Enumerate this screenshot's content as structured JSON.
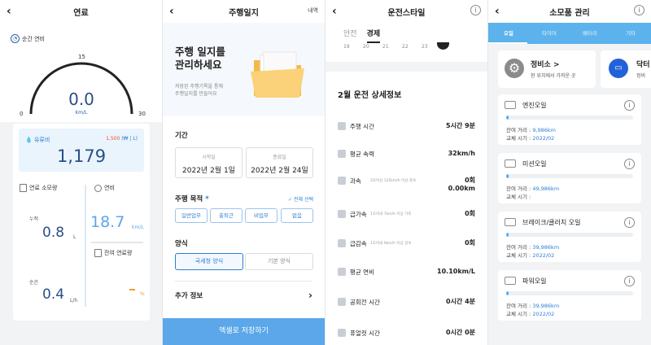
{
  "panel1": {
    "title": "연료",
    "instant_label": "순간 연비",
    "gauge": {
      "min": "0",
      "mid": "15",
      "max": "30",
      "value": "0.0",
      "unit": "km/L",
      "level": 0
    },
    "fuel_cost": {
      "label": "유류비",
      "rate": "1,500",
      "rate_unit": "(₩ | L)",
      "value": "1,179"
    },
    "consumption_label": "연료 소모량",
    "efficiency_label": "연비",
    "cumulative_label": "누적",
    "cumulative_value": "0.8",
    "cumulative_unit": "L",
    "efficiency_value": "18.7",
    "efficiency_unit": "km/L",
    "remaining_label": "잔여 연료량",
    "instant2_label": "순간",
    "instant2_value": "0.4",
    "instant2_unit": "L/h",
    "remaining_unit": "%",
    "colors": {
      "accent": "#2b4f85",
      "blue": "#2d7fd3",
      "orange": "#f29a3a"
    }
  },
  "panel2": {
    "title": "주행일지",
    "right_link": "내역",
    "hero_title": [
      "주행 일지를",
      "관리하세요"
    ],
    "hero_desc": [
      "저장된 주행기록을 통해",
      "주행일지를 만들어요"
    ],
    "period_label": "기간",
    "start": {
      "label": "시작일",
      "value": "2022년 2월 1일"
    },
    "end": {
      "label": "종료일",
      "value": "2022년 2월 24일"
    },
    "purpose_label": "주행 목적",
    "purpose_required": "*",
    "select_all": "✓ 전체 선택",
    "purposes": [
      "일반업무",
      "출퇴근",
      "비업무",
      "없음"
    ],
    "format_label": "양식",
    "formats": [
      "국세청 양식",
      "기본 양식"
    ],
    "extra_label": "추가 정보",
    "save_button": "엑셀로 저장하기"
  },
  "panel3": {
    "title": "운전스타일",
    "tabs": [
      "안전",
      "경제"
    ],
    "date_strip": [
      "19",
      "20",
      "21",
      "22",
      "23"
    ],
    "detail_title": "2월 운전 상세정보",
    "rows": [
      {
        "label": "주행 시간",
        "sub": "",
        "value": "5시간 9분",
        "value2": ""
      },
      {
        "label": "평균 속력",
        "sub": "",
        "value": "32km/h",
        "value2": ""
      },
      {
        "label": "과속",
        "sub": "3초이상 125km/h 이상 과속",
        "value": "0회",
        "value2": "0.00km"
      },
      {
        "label": "급가속",
        "sub": "1초이내 7km/h 이상 가속",
        "value": "0회",
        "value2": ""
      },
      {
        "label": "급감속",
        "sub": "1초이내 9km/h 이상 감속",
        "value": "0회",
        "value2": ""
      },
      {
        "label": "평균 연비",
        "sub": "",
        "value": "10.10km/L",
        "value2": ""
      },
      {
        "label": "공회전 시간",
        "sub": "",
        "value": "0시간 4분",
        "value2": ""
      },
      {
        "label": "퓨얼컷 시간",
        "sub": "",
        "value": "0시간 0분",
        "value2": ""
      }
    ]
  },
  "panel4": {
    "title": "소모품 관리",
    "tabs": [
      "오일",
      "타이어",
      "배터리",
      "기타"
    ],
    "shop": {
      "name": "정비소 >",
      "desc": "현 위치에서 가까운 곳"
    },
    "shop2": {
      "name": "닥터",
      "desc": "정비"
    },
    "items": [
      {
        "name": "엔진오일",
        "dist_label": "잔여 거리 : ",
        "dist": "9,986km",
        "date_label": "교체 시기 : ",
        "date": "2022/02",
        "level": 0.02
      },
      {
        "name": "미션오일",
        "dist_label": "잔여 거리 : ",
        "dist": "49,986km",
        "date_label": "교체 시기 : ",
        "date": "",
        "level": 0.02
      },
      {
        "name": "브레이크/클러치 오일",
        "dist_label": "잔여 거리 : ",
        "dist": "39,986km",
        "date_label": "교체 시기 : ",
        "date": "2022/02",
        "level": 0.02
      },
      {
        "name": "파워오일",
        "dist_label": "잔여 거리 : ",
        "dist": "39,986km",
        "date_label": "교체 시기 : ",
        "date": "2022/02",
        "level": 0.02
      }
    ]
  }
}
